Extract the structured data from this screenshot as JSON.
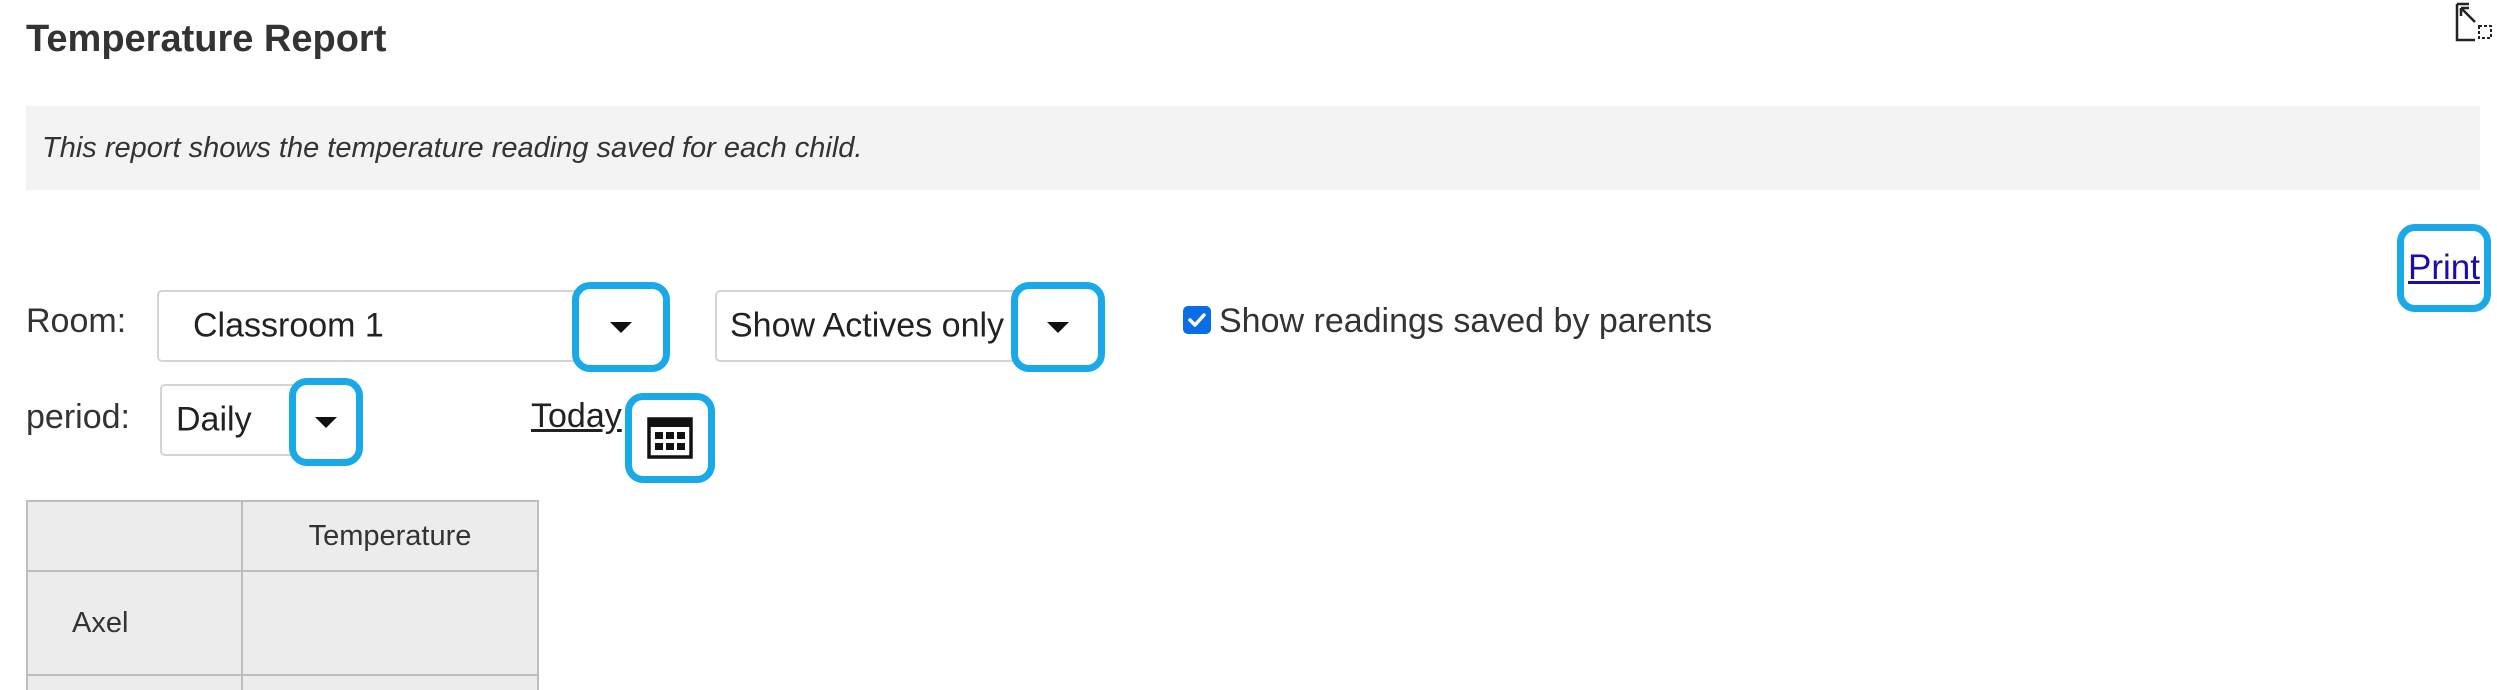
{
  "page": {
    "title": "Temperature Report",
    "description": "This report shows the temperature reading saved for each child.",
    "print_label": "Print"
  },
  "filters": {
    "room_label": "Room:",
    "room_value": "Classroom 1",
    "active_value": "Show Actives only",
    "parents_checkbox": {
      "label": "Show readings saved by parents",
      "checked": true
    },
    "period_label": "period:",
    "period_value": "Daily",
    "date_label": "Today"
  },
  "table": {
    "headers": [
      "",
      "Temperature"
    ],
    "rows": [
      {
        "name": "Axel",
        "temperature": ""
      }
    ]
  },
  "icons": {
    "expand": "expand-icon",
    "dropdown": "chevron-down-icon",
    "calendar": "calendar-icon",
    "checkbox": "check-icon"
  },
  "colors": {
    "highlight": "#1aa9e8",
    "link": "#1a0dab",
    "checkbox": "#0a6de8",
    "desc_bg": "#f3f3f3",
    "table_bg": "#ececec"
  }
}
